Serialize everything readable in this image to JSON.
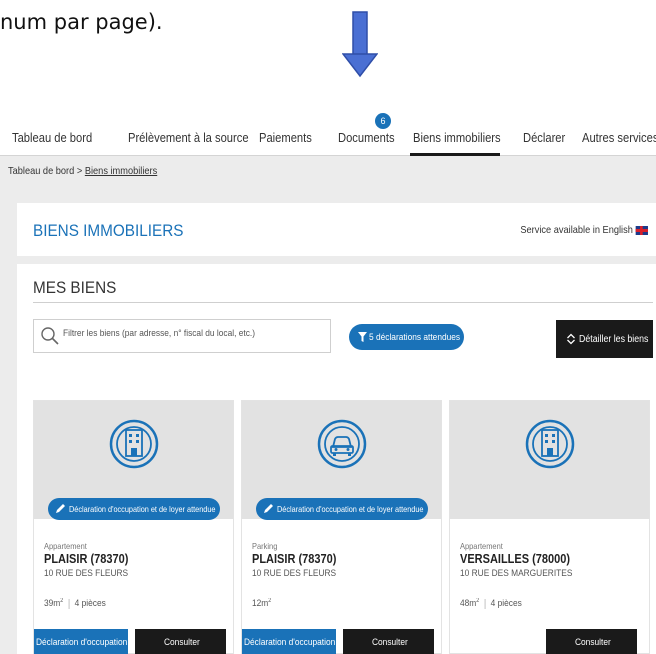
{
  "caption": {
    "text": "num par page)."
  },
  "nav": {
    "items": [
      {
        "label": "Tableau de bord"
      },
      {
        "label": "Prélèvement à la source"
      },
      {
        "label": "Paiements"
      },
      {
        "label": "Documents",
        "badge": "6"
      },
      {
        "label": "Biens immobiliers",
        "active": true
      },
      {
        "label": "Déclarer"
      },
      {
        "label": "Autres services"
      }
    ]
  },
  "breadcrumb": {
    "home": "Tableau de bord",
    "separator": ">",
    "current": "Biens immobiliers"
  },
  "header": {
    "title": "BIENS IMMOBILIERS",
    "english_link": "Service available in English"
  },
  "section": {
    "title": "MES BIENS"
  },
  "search": {
    "placeholder": "Filtrer les biens (par adresse, n° fiscal du local, etc.)"
  },
  "declarations_button": {
    "label": "5 déclarations attendues"
  },
  "details_button": {
    "label": "Détailler les biens"
  },
  "cards": [
    {
      "icon": "building-icon",
      "pill": "Déclaration d'occupation et de loyer attendue",
      "type": "Appartement",
      "city": "PLAISIR  (78370)",
      "street": "10 RUE DES FLEURS",
      "area": "39m",
      "area_sup": "2",
      "rooms": "4 pièces",
      "decl_label": "Déclaration d'occupation",
      "consult_label": "Consulter"
    },
    {
      "icon": "car-icon",
      "pill": "Déclaration d'occupation et de loyer attendue",
      "type": "Parking",
      "city": "PLAISIR  (78370)",
      "street": "10 RUE DES FLEURS",
      "area": "12m",
      "area_sup": "2",
      "rooms": "",
      "decl_label": "Déclaration d'occupation",
      "consult_label": "Consulter"
    },
    {
      "icon": "building-icon",
      "pill": "",
      "type": "Appartement",
      "city": "VERSAILLES  (78000)",
      "street": "10 RUE DES MARGUERITES",
      "area": "48m",
      "area_sup": "2",
      "rooms": "4 pièces",
      "decl_label": "",
      "consult_label": "Consulter"
    }
  ],
  "colors": {
    "accent": "#1a72b8",
    "dark": "#1a1a1a",
    "background": "#ececec"
  }
}
